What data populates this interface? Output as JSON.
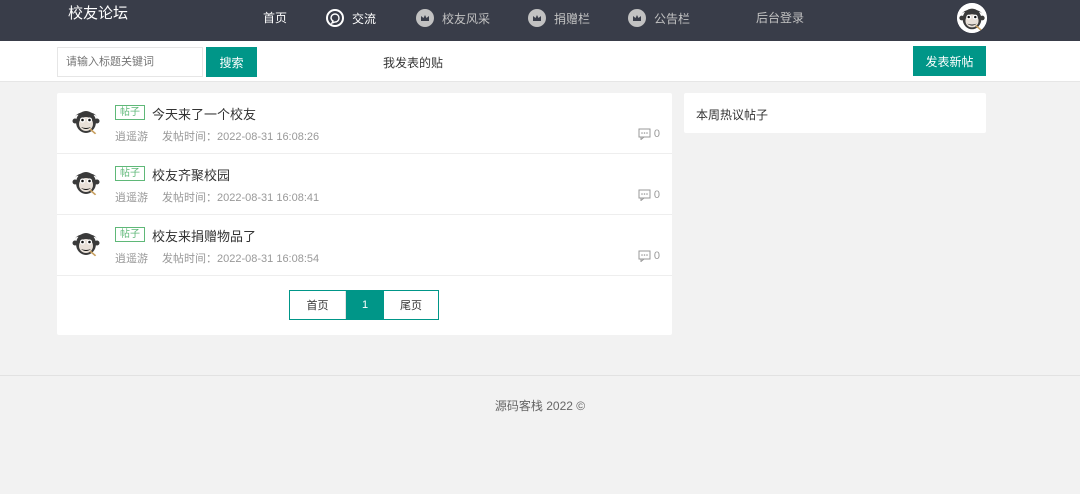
{
  "header": {
    "logo": "校友论坛",
    "nav": [
      {
        "label": "首页",
        "icon": "none"
      },
      {
        "label": "交流",
        "icon": "chat-bubble-icon"
      },
      {
        "label": "校友风采",
        "icon": "crown-icon"
      },
      {
        "label": "捐赠栏",
        "icon": "crown-icon"
      },
      {
        "label": "公告栏",
        "icon": "crown-icon"
      },
      {
        "label": "后台登录",
        "icon": "none"
      }
    ]
  },
  "toolbar": {
    "search_placeholder": "请输入标题关键词",
    "search_value": "",
    "search_label": "搜索",
    "my_posts_label": "我发表的贴",
    "new_post_label": "发表新帖"
  },
  "posts": [
    {
      "tag": "帖子",
      "title": "今天来了一个校友",
      "author": "逍遥游",
      "time": "发帖时间：2022-08-31 16:08:26",
      "comments": "0"
    },
    {
      "tag": "帖子",
      "title": "校友齐聚校园",
      "author": "逍遥游",
      "time": "发帖时间：2022-08-31 16:08:41",
      "comments": "0"
    },
    {
      "tag": "帖子",
      "title": "校友来捐赠物品了",
      "author": "逍遥游",
      "time": "发帖时间：2022-08-31 16:08:54",
      "comments": "0"
    }
  ],
  "pagination": {
    "first": "首页",
    "current": "1",
    "last": "尾页"
  },
  "sidebar": {
    "hot_title": "本周热议帖子"
  },
  "footer": {
    "text": "源码客栈   2022 ©"
  },
  "colors": {
    "accent": "#009688",
    "header_bg": "#393d49",
    "tag": "#5fb878"
  }
}
